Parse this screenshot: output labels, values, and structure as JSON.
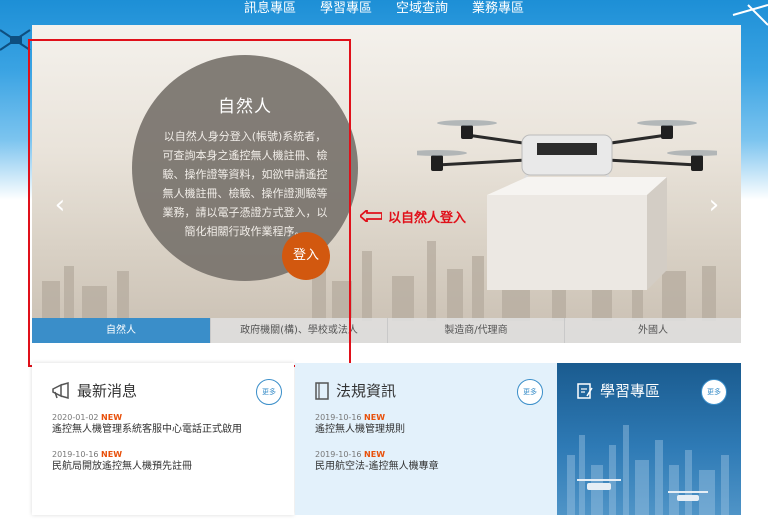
{
  "nav": {
    "items": [
      "訊息專區",
      "學習專區",
      "空域查詢",
      "業務專區"
    ]
  },
  "hero": {
    "prev_symbol": "‹",
    "next_symbol": "›",
    "title": "自然人",
    "description": "以自然人身分登入(帳號)系統者，可查詢本身之遙控無人機註冊、檢驗、操作證等資料，如欲申請遙控無人機註冊、檢驗、操作證測驗等業務，請以電子憑證方式登入，以簡化相關行政作業程序。",
    "login_label": "登入",
    "tabs": [
      "自然人",
      "政府機關(構)、學校或法人",
      "製造商/代理商",
      "外國人"
    ],
    "active_tab": 0
  },
  "annotation": {
    "text": "以自然人登入",
    "color": "#e0101a"
  },
  "panels": {
    "news": {
      "title": "最新消息",
      "more_label": "更多",
      "items": [
        {
          "date": "2020-01-02",
          "badge": "NEW",
          "title": "遙控無人機管理系統客服中心電話正式啟用"
        },
        {
          "date": "2019-10-16",
          "badge": "NEW",
          "title": "民航局開放遙控無人機預先註冊"
        }
      ]
    },
    "laws": {
      "title": "法規資訊",
      "more_label": "更多",
      "items": [
        {
          "date": "2019-10-16",
          "badge": "NEW",
          "title": "遙控無人機管理規則"
        },
        {
          "date": "2019-10-16",
          "badge": "NEW",
          "title": "民用航空法-遙控無人機專章"
        }
      ]
    },
    "learning": {
      "title": "學習專區",
      "more_label": "更多"
    }
  },
  "colors": {
    "accent": "#3a8ec9",
    "login": "#d2580f",
    "badge_new": "#e8500b"
  }
}
